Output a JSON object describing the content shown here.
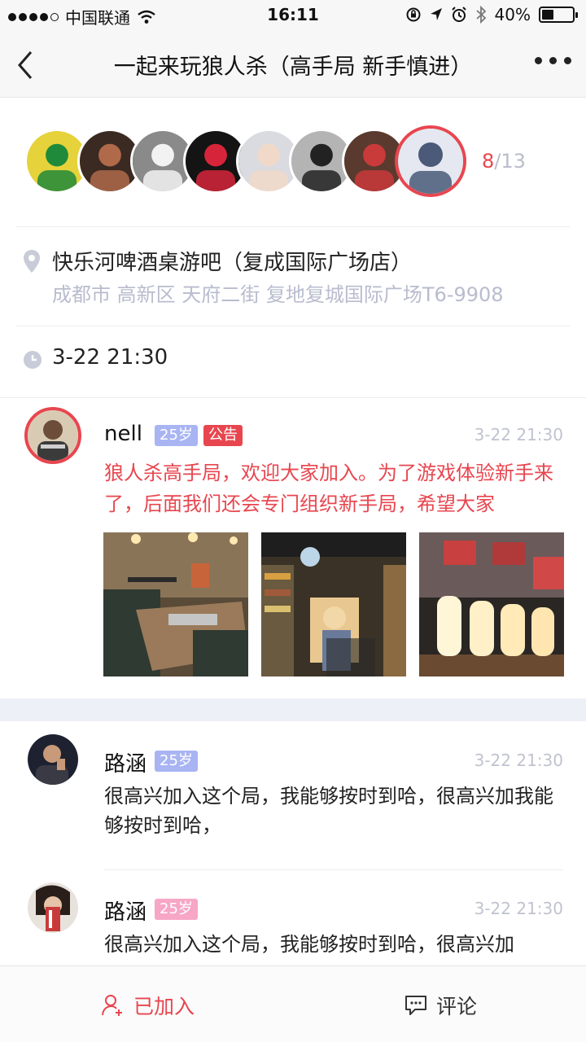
{
  "status_bar": {
    "carrier": "中国联通",
    "time": "16:11",
    "battery_text": "40%",
    "battery_level": 0.4
  },
  "nav": {
    "title": "一起来玩狼人杀（高手局  新手慎进）"
  },
  "participants": {
    "count_current": "8",
    "count_separator": "/",
    "count_total": "13",
    "avatars": [
      {
        "name": "avatar-1",
        "bg": "#e6d23a",
        "fg": "#1f8a3a"
      },
      {
        "name": "avatar-2",
        "bg": "#3a2a22",
        "fg": "#b06a4a"
      },
      {
        "name": "avatar-3",
        "bg": "#8a8a8a",
        "fg": "#f2f2f2"
      },
      {
        "name": "avatar-4",
        "bg": "#141414",
        "fg": "#d6253a"
      },
      {
        "name": "avatar-5",
        "bg": "#d9dbe0",
        "fg": "#f0d9c8"
      },
      {
        "name": "avatar-6",
        "bg": "#b4b4b4",
        "fg": "#222222"
      },
      {
        "name": "avatar-7",
        "bg": "#5a3a2e",
        "fg": "#c93a3a"
      },
      {
        "name": "avatar-8-host",
        "bg": "#e5e8f0",
        "fg": "#4a5a78"
      }
    ]
  },
  "location": {
    "name": "快乐河啤酒桌游吧（复成国际广场店）",
    "address": "成都市 高新区 天府二街 复地复城国际广场T6-9908"
  },
  "event_time": "3-22 21:30",
  "announcement": {
    "author": "nell",
    "age": "25岁",
    "badge": "公告",
    "timestamp": "3-22 21:30",
    "text": "狼人杀高手局，欢迎大家加入。为了游戏体验新手来了，后面我们还会专门组织新手局，希望大家",
    "photos": [
      "bar-interior-photo",
      "bookshelf-store-photo",
      "lamps-on-table-photo"
    ]
  },
  "comments": [
    {
      "author": "路涵",
      "age": "25岁",
      "age_color": "blue",
      "timestamp": "3-22 21:30",
      "text": "很高兴加入这个局，我能够按时到哈，很高兴加我能够按时到哈，"
    },
    {
      "author": "路涵",
      "age": "25岁",
      "age_color": "pink",
      "timestamp": "3-22 21:30",
      "text": "很高兴加入这个局，我能够按时到哈，很高兴加"
    }
  ],
  "bottom_bar": {
    "joined_label": "已加入",
    "comment_label": "评论"
  },
  "colors": {
    "accent_red": "#e8464f",
    "muted_text": "#b8bcce",
    "age_badge_blue": "#a9b4f3",
    "age_badge_pink": "#f7a6c5"
  }
}
